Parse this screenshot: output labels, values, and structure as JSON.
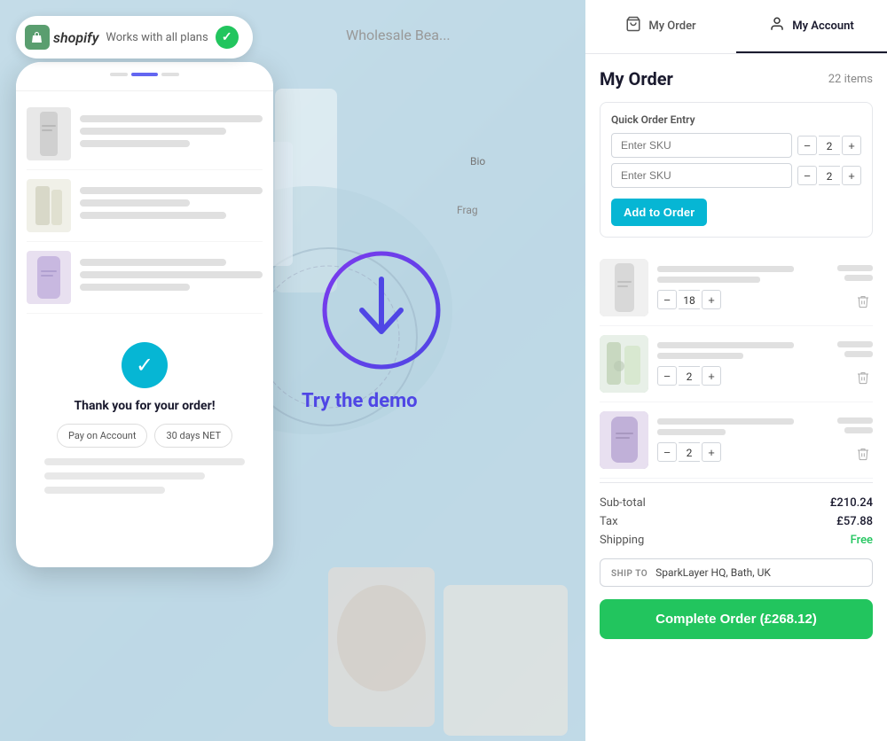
{
  "header": {
    "myOrder": "My Order",
    "myAccount": "My Account",
    "myOrderIcon": "🛍",
    "myAccountIcon": "👤"
  },
  "shopify": {
    "badge": "Works with all plans",
    "logo_text": "shopify"
  },
  "wholesale": {
    "text": "Wholesale Bea"
  },
  "bio": {
    "text": "Bio"
  },
  "frag": {
    "text": "Frag"
  },
  "demo": {
    "cta_text": "Try the demo"
  },
  "mobile": {
    "thank_you_text": "Thank you for your order!",
    "payment_btn1": "Pay on Account",
    "payment_btn2": "30 days NET"
  },
  "order": {
    "title": "My Order",
    "items_count": "22 items",
    "quick_entry_label": "Quick Order Entry",
    "sku_placeholder": "Enter SKU",
    "qty1": "2",
    "qty2": "2",
    "add_btn": "Add to Order",
    "products": [
      {
        "qty": "18",
        "img_class": "item1"
      },
      {
        "qty": "2",
        "img_class": "item2"
      },
      {
        "qty": "2",
        "img_class": "item3"
      }
    ],
    "subtotal_label": "Sub-total",
    "subtotal_value": "£210.24",
    "tax_label": "Tax",
    "tax_value": "£57.88",
    "shipping_label": "Shipping",
    "shipping_value": "Free",
    "ship_to_label": "SHIP TO",
    "ship_to_value": "SparkLayer HQ, Bath, UK",
    "complete_btn": "Complete Order (£268.12)"
  },
  "colors": {
    "accent_blue": "#4f46e5",
    "accent_cyan": "#06b6d4",
    "accent_green": "#22c55e",
    "shopify_green": "#5a9e6f",
    "dark_navy": "#1a2744"
  }
}
